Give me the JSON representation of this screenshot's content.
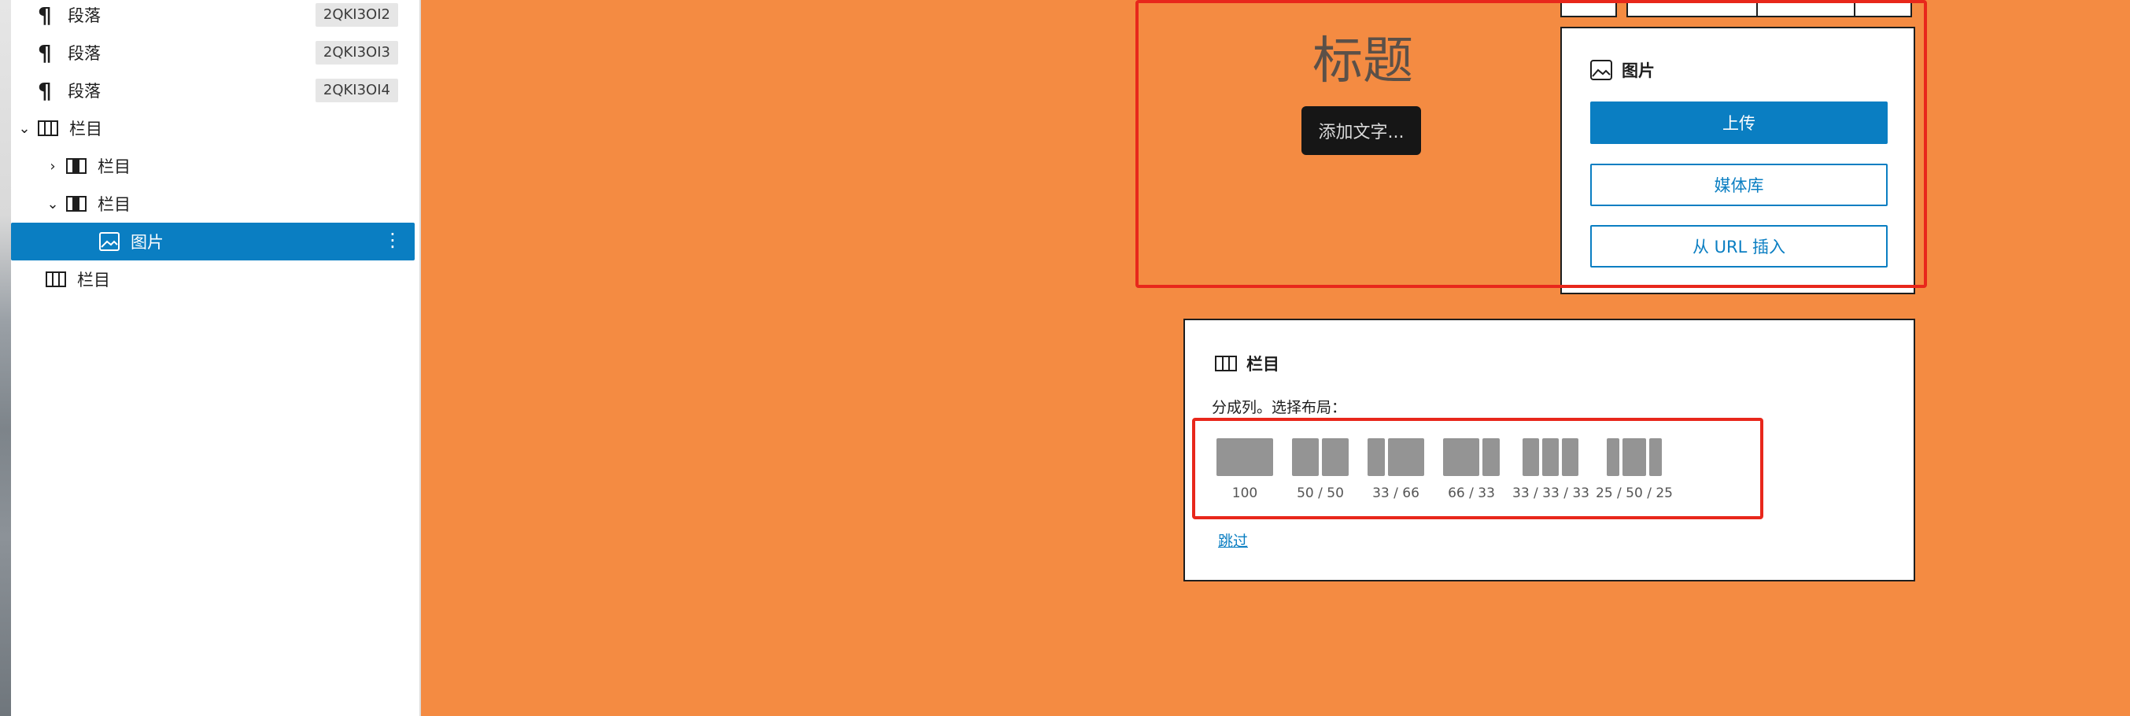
{
  "list_view": {
    "items": [
      {
        "label": "段落",
        "icon": "paragraph-icon",
        "anchor": "2QKI3OI2"
      },
      {
        "label": "段落",
        "icon": "paragraph-icon",
        "anchor": "2QKI3OI3"
      },
      {
        "label": "段落",
        "icon": "paragraph-icon",
        "anchor": "2QKI3OI4"
      },
      {
        "label": "栏目",
        "icon": "columns-icon",
        "expanded": true
      },
      {
        "label": "栏目",
        "icon": "column-icon",
        "expanded": false
      },
      {
        "label": "栏目",
        "icon": "column-icon",
        "expanded": true
      },
      {
        "label": "图片",
        "icon": "image-icon",
        "selected": true
      },
      {
        "label": "栏目",
        "icon": "columns-icon"
      }
    ]
  },
  "canvas": {
    "heading_text": "标题",
    "add_text_button": "添加文字..."
  },
  "image_placeholder": {
    "title": "图片",
    "upload_button": "上传",
    "media_library_button": "媒体库",
    "insert_url_button": "从 URL 插入"
  },
  "columns_placeholder": {
    "title": "栏目",
    "instructions": "分成列。选择布局：",
    "layouts": [
      {
        "label": "100"
      },
      {
        "label": "50 / 50"
      },
      {
        "label": "33 / 66"
      },
      {
        "label": "66 / 33"
      },
      {
        "label": "33 / 33 / 33"
      },
      {
        "label": "25 / 50 / 25"
      }
    ],
    "skip_link": "跳过"
  },
  "colors": {
    "canvas_background": "#f48b42",
    "accent": "#0a7ec2",
    "highlight_box": "#e8271b",
    "selected_row": "#0a7ec2"
  }
}
